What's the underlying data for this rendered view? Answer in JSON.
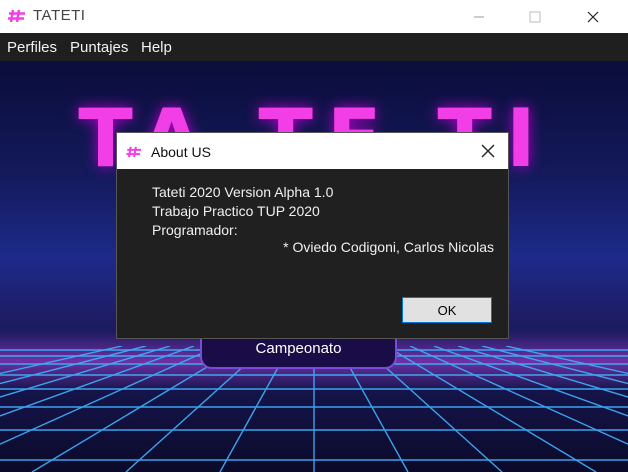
{
  "window": {
    "title": "TATETI",
    "icon": "hashtag-icon",
    "accent_color": "#f23ee6"
  },
  "menu": {
    "items": [
      {
        "label": "Perfiles"
      },
      {
        "label": "Puntajes"
      },
      {
        "label": "Help"
      }
    ]
  },
  "background": {
    "title": "TA TE TI",
    "button_label": "Campeonato"
  },
  "dialog": {
    "title": "About US",
    "lines": [
      "Tateti 2020 Version Alpha 1.0",
      "Trabajo Practico TUP 2020",
      "Programador:",
      "* Oviedo Codigoni, Carlos Nicolas"
    ],
    "ok_label": "OK"
  }
}
